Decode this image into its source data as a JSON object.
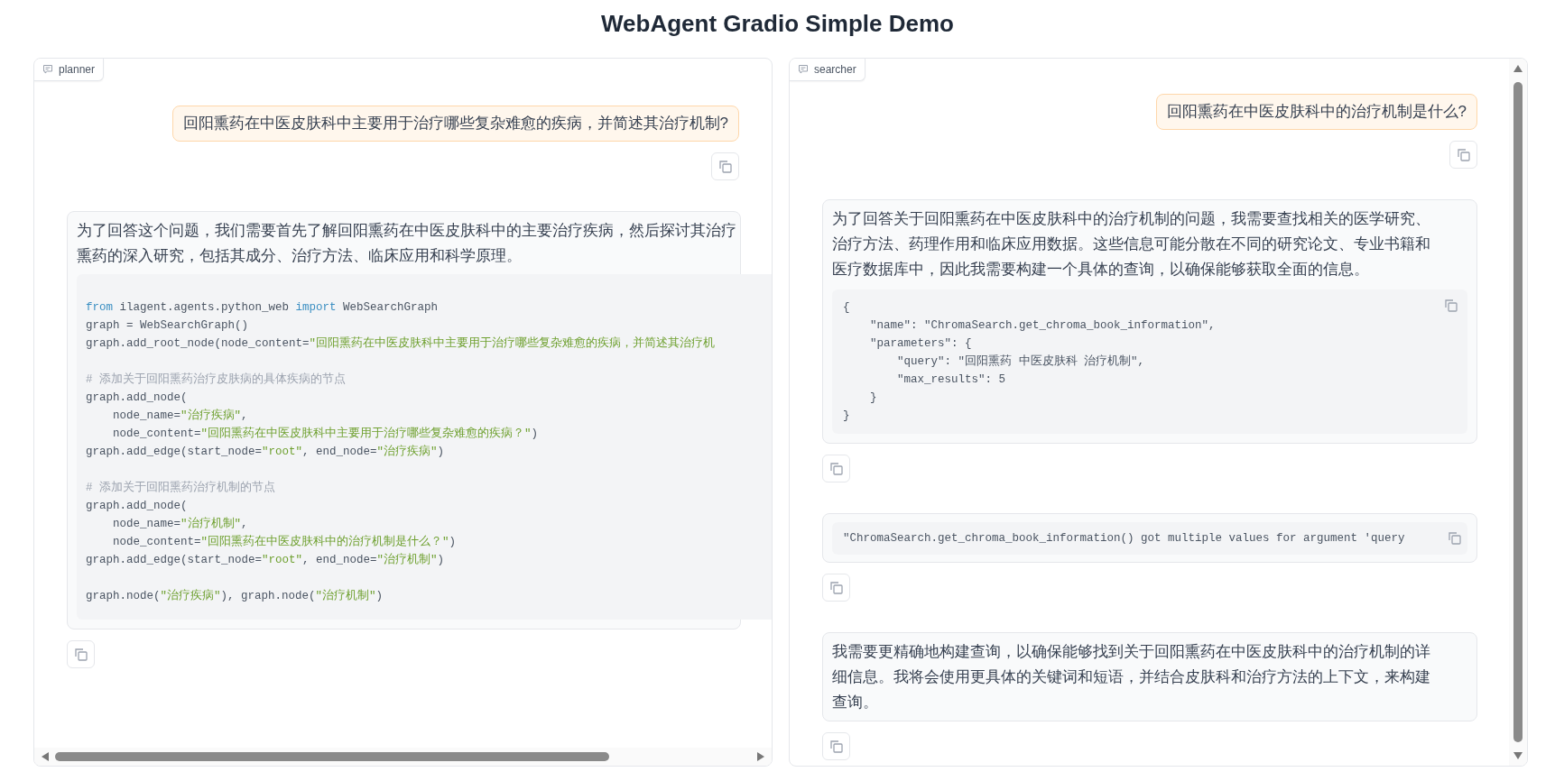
{
  "title": "WebAgent Gradio Simple Demo",
  "panels": [
    {
      "label": "planner",
      "kind": "horizontal",
      "messages": [
        {
          "kind": "user",
          "blocks": [
            {
              "kind": "paragraph",
              "lines": [
                "回阳熏药在中医皮肤科中主要用于治疗哪些复杂难愈的疾病，并简述其治疗机制?"
              ]
            }
          ]
        },
        {
          "kind": "bot",
          "blocks": [
            {
              "kind": "paragraph",
              "lines": [
                "为了回答这个问题，我们需要首先了解回阳熏药在中医皮肤科中的主要治疗疾病，然后探讨其治疗",
                "熏药的深入研究，包括其成分、治疗方法、临床应用和科学原理。"
              ]
            },
            {
              "kind": "code",
              "lines": [
                {
                  "kind": "text",
                  "parts": [
                    {
                      "kind": "keyword",
                      "text": "from"
                    },
                    {
                      "kind": "plain",
                      "text": " ilagent.agents.python_web "
                    },
                    {
                      "kind": "keyword",
                      "text": "import"
                    },
                    {
                      "kind": "plain",
                      "text": " WebSearchGraph"
                    }
                  ]
                },
                {
                  "kind": "text",
                  "parts": [
                    {
                      "kind": "plain",
                      "text": "graph = WebSearchGraph()"
                    }
                  ]
                },
                {
                  "kind": "text",
                  "parts": [
                    {
                      "kind": "plain",
                      "text": "graph.add_root_node(node_content="
                    },
                    {
                      "kind": "string",
                      "text": "\"回阳熏药在中医皮肤科中主要用于治疗哪些复杂难愈的疾病，并简述其治疗机"
                    }
                  ]
                },
                {
                  "kind": "blank"
                },
                {
                  "kind": "text",
                  "parts": [
                    {
                      "kind": "comment",
                      "text": "# 添加关于回阳熏药治疗皮肤病的具体疾病的节点"
                    }
                  ]
                },
                {
                  "kind": "text",
                  "parts": [
                    {
                      "kind": "plain",
                      "text": "graph.add_node("
                    }
                  ]
                },
                {
                  "kind": "text",
                  "parts": [
                    {
                      "kind": "plain",
                      "text": "    node_name="
                    },
                    {
                      "kind": "string",
                      "text": "\"治疗疾病\""
                    },
                    {
                      "kind": "plain",
                      "text": ","
                    }
                  ]
                },
                {
                  "kind": "text",
                  "parts": [
                    {
                      "kind": "plain",
                      "text": "    node_content="
                    },
                    {
                      "kind": "string",
                      "text": "\"回阳熏药在中医皮肤科中主要用于治疗哪些复杂难愈的疾病？\""
                    },
                    {
                      "kind": "plain",
                      "text": ")"
                    }
                  ]
                },
                {
                  "kind": "text",
                  "parts": [
                    {
                      "kind": "plain",
                      "text": "graph.add_edge(start_node="
                    },
                    {
                      "kind": "string",
                      "text": "\"root\""
                    },
                    {
                      "kind": "plain",
                      "text": ", end_node="
                    },
                    {
                      "kind": "string",
                      "text": "\"治疗疾病\""
                    },
                    {
                      "kind": "plain",
                      "text": ")"
                    }
                  ]
                },
                {
                  "kind": "blank"
                },
                {
                  "kind": "text",
                  "parts": [
                    {
                      "kind": "comment",
                      "text": "# 添加关于回阳熏药治疗机制的节点"
                    }
                  ]
                },
                {
                  "kind": "text",
                  "parts": [
                    {
                      "kind": "plain",
                      "text": "graph.add_node("
                    }
                  ]
                },
                {
                  "kind": "text",
                  "parts": [
                    {
                      "kind": "plain",
                      "text": "    node_name="
                    },
                    {
                      "kind": "string",
                      "text": "\"治疗机制\""
                    },
                    {
                      "kind": "plain",
                      "text": ","
                    }
                  ]
                },
                {
                  "kind": "text",
                  "parts": [
                    {
                      "kind": "plain",
                      "text": "    node_content="
                    },
                    {
                      "kind": "string",
                      "text": "\"回阳熏药在中医皮肤科中的治疗机制是什么？\""
                    },
                    {
                      "kind": "plain",
                      "text": ")"
                    }
                  ]
                },
                {
                  "kind": "text",
                  "parts": [
                    {
                      "kind": "plain",
                      "text": "graph.add_edge(start_node="
                    },
                    {
                      "kind": "string",
                      "text": "\"root\""
                    },
                    {
                      "kind": "plain",
                      "text": ", end_node="
                    },
                    {
                      "kind": "string",
                      "text": "\"治疗机制\""
                    },
                    {
                      "kind": "plain",
                      "text": ")"
                    }
                  ]
                },
                {
                  "kind": "blank"
                },
                {
                  "kind": "text",
                  "parts": [
                    {
                      "kind": "plain",
                      "text": "graph.node("
                    },
                    {
                      "kind": "string",
                      "text": "\"治疗疾病\""
                    },
                    {
                      "kind": "plain",
                      "text": "), graph.node("
                    },
                    {
                      "kind": "string",
                      "text": "\"治疗机制\""
                    },
                    {
                      "kind": "plain",
                      "text": ")"
                    }
                  ]
                }
              ]
            }
          ]
        }
      ]
    },
    {
      "label": "searcher",
      "kind": "vertical",
      "messages": [
        {
          "kind": "user",
          "blocks": [
            {
              "kind": "paragraph",
              "lines": [
                "回阳熏药在中医皮肤科中的治疗机制是什么?"
              ]
            }
          ]
        },
        {
          "kind": "bot",
          "blocks": [
            {
              "kind": "paragraph",
              "lines": [
                "为了回答关于回阳熏药在中医皮肤科中的治疗机制的问题，我需要查找相关的医学研究、",
                "治疗方法、药理作用和临床应用数据。这些信息可能分散在不同的研究论文、专业书籍和",
                "医疗数据库中，因此我需要构建一个具体的查询，以确保能够获取全面的信息。"
              ]
            },
            {
              "kind": "json",
              "lines": [
                "{",
                "    \"name\": \"ChromaSearch.get_chroma_book_information\",",
                "    \"parameters\": {",
                "        \"query\": \"回阳熏药 中医皮肤科 治疗机制\",",
                "        \"max_results\": 5",
                "    }",
                "}"
              ]
            }
          ]
        },
        {
          "kind": "bot",
          "blocks": [
            {
              "kind": "error",
              "lines": [
                "\"ChromaSearch.get_chroma_book_information() got multiple values for argument 'query"
              ]
            }
          ]
        },
        {
          "kind": "bot",
          "blocks": [
            {
              "kind": "paragraph",
              "lines": [
                "我需要更精确地构建查询，以确保能够找到关于回阳熏药在中医皮肤科中的治疗机制的详",
                "细信息。我将会使用更具体的关键词和短语，并结合皮肤科和治疗方法的上下文，来构建",
                "查询。"
              ]
            }
          ]
        }
      ]
    }
  ]
}
